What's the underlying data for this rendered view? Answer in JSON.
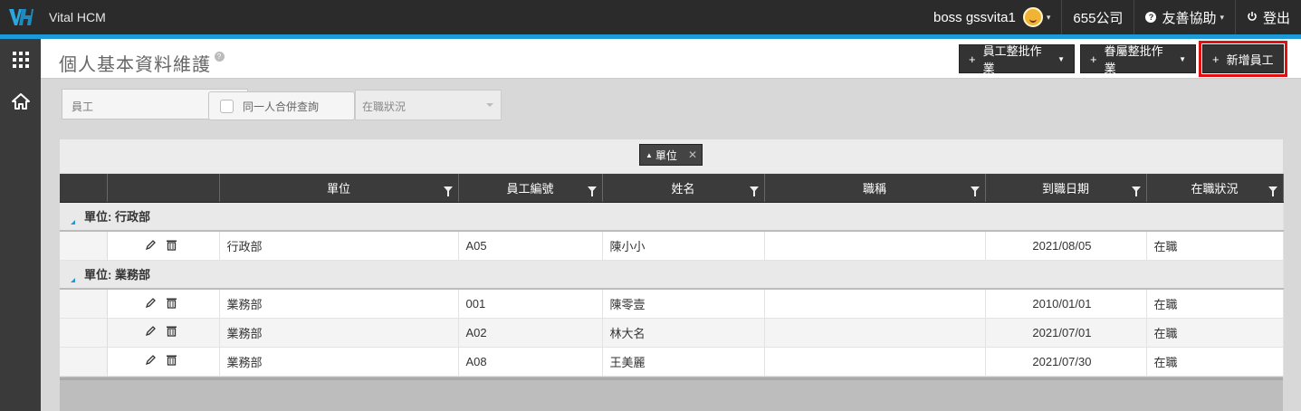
{
  "app": {
    "name": "Vital HCM",
    "user": "boss gssvita1",
    "company": "655公司",
    "help": "友善協助",
    "logout": "登出"
  },
  "page": {
    "title": "個人基本資料維護",
    "buttons": {
      "batch_employee": "員工整批作業",
      "batch_dependent": "眷屬整批作業",
      "add_employee": "新增員工"
    }
  },
  "filters": {
    "employee_label": "員工",
    "merge_query": "同一人合併查詢",
    "status_placeholder": "在職狀況"
  },
  "grid": {
    "group_chip": "單位",
    "columns": [
      "單位",
      "員工編號",
      "姓名",
      "職稱",
      "到職日期",
      "在職狀況"
    ],
    "groups": [
      {
        "label": "單位: 行政部",
        "rows": [
          {
            "unit": "行政部",
            "emp_no": "A05",
            "name": "陳小小",
            "title": "",
            "hire_date": "2021/08/05",
            "status": "在職"
          }
        ]
      },
      {
        "label": "單位: 業務部",
        "rows": [
          {
            "unit": "業務部",
            "emp_no": "001",
            "name": "陳零壹",
            "title": "",
            "hire_date": "2010/01/01",
            "status": "在職"
          },
          {
            "unit": "業務部",
            "emp_no": "A02",
            "name": "林大名",
            "title": "",
            "hire_date": "2021/07/01",
            "status": "在職"
          },
          {
            "unit": "業務部",
            "emp_no": "A08",
            "name": "王美麗",
            "title": "",
            "hire_date": "2021/07/30",
            "status": "在職"
          }
        ]
      }
    ]
  },
  "colors": {
    "topbar": "#2b2b2b",
    "accent": "#1d9bd8",
    "button": "#333333",
    "highlight": "#e01010"
  }
}
